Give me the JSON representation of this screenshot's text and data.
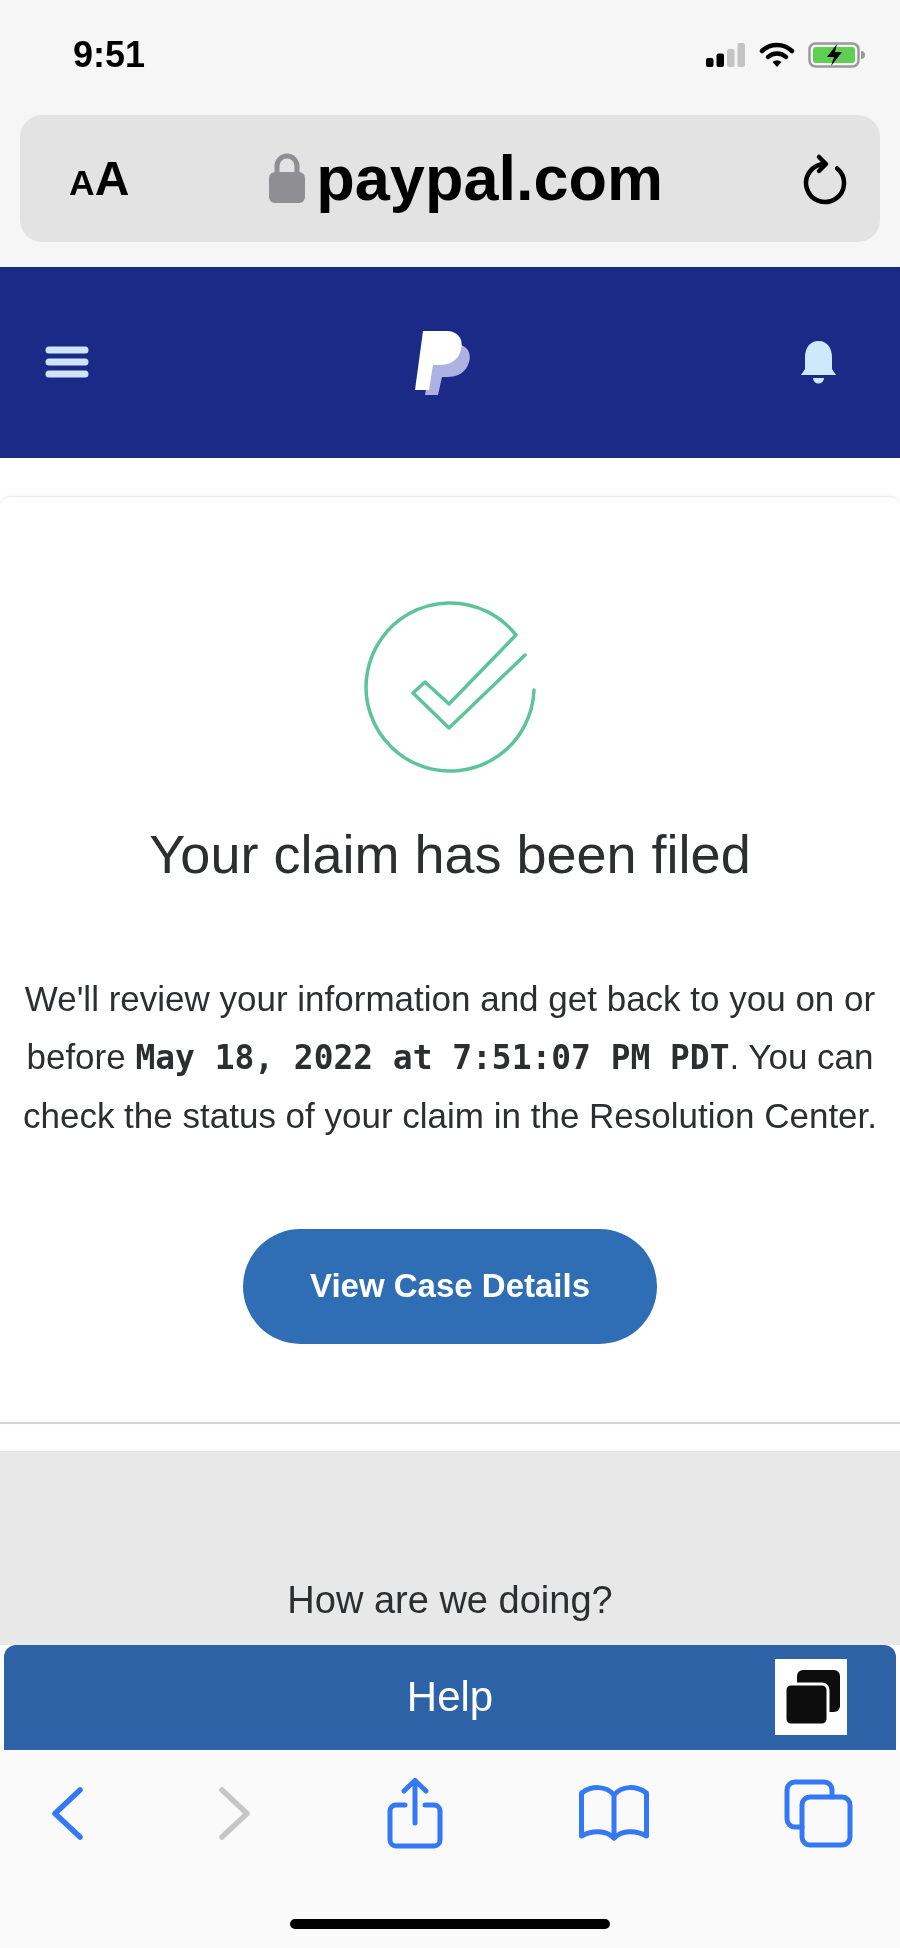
{
  "status_bar": {
    "time": "9:51"
  },
  "address_bar": {
    "text_size": "AA",
    "url": "paypal.com"
  },
  "confirmation": {
    "title": "Your claim has been filed",
    "message": "We'll review your information and get back to you on or before **May 18, 2022 at 7:51:07 PM PDT**. You can check the status of your claim in the Resolution Center.",
    "button": "View Case Details"
  },
  "feedback": {
    "question": "How are we doing?"
  },
  "help_bar": {
    "label": "Help"
  },
  "toolbar": {
    "buttons": [
      {
        "kind": "back",
        "disabled": false
      },
      {
        "kind": "forward",
        "disabled": true
      },
      {
        "kind": "share",
        "disabled": false
      },
      {
        "kind": "bookmarks",
        "disabled": false
      },
      {
        "kind": "tabs",
        "disabled": false
      }
    ]
  }
}
